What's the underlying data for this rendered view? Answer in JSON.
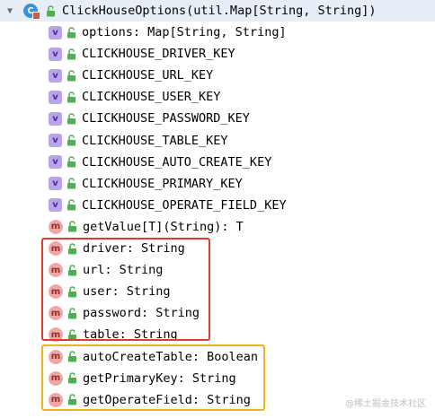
{
  "class_node": {
    "label": "ClickHouseOptions(util.Map[String, String])",
    "icon": "scala-class-icon",
    "icon_letter": "C",
    "expander": "expanded-arrow-icon"
  },
  "members": [
    {
      "kind": "val",
      "icon_letter": "v",
      "label": "options: Map[String, String]"
    },
    {
      "kind": "val",
      "icon_letter": "v",
      "label": "CLICKHOUSE_DRIVER_KEY"
    },
    {
      "kind": "val",
      "icon_letter": "v",
      "label": "CLICKHOUSE_URL_KEY"
    },
    {
      "kind": "val",
      "icon_letter": "v",
      "label": "CLICKHOUSE_USER_KEY"
    },
    {
      "kind": "val",
      "icon_letter": "v",
      "label": "CLICKHOUSE_PASSWORD_KEY"
    },
    {
      "kind": "val",
      "icon_letter": "v",
      "label": "CLICKHOUSE_TABLE_KEY"
    },
    {
      "kind": "val",
      "icon_letter": "v",
      "label": "CLICKHOUSE_AUTO_CREATE_KEY"
    },
    {
      "kind": "val",
      "icon_letter": "v",
      "label": "CLICKHOUSE_PRIMARY_KEY"
    },
    {
      "kind": "val",
      "icon_letter": "v",
      "label": "CLICKHOUSE_OPERATE_FIELD_KEY"
    },
    {
      "kind": "method",
      "icon_letter": "m",
      "label": "getValue[T](String): T"
    },
    {
      "kind": "method",
      "icon_letter": "m",
      "label": "driver: String"
    },
    {
      "kind": "method",
      "icon_letter": "m",
      "label": "url: String"
    },
    {
      "kind": "method",
      "icon_letter": "m",
      "label": "user: String"
    },
    {
      "kind": "method",
      "icon_letter": "m",
      "label": "password: String"
    },
    {
      "kind": "method",
      "icon_letter": "m",
      "label": "table: String"
    },
    {
      "kind": "method",
      "icon_letter": "m",
      "label": "autoCreateTable: Boolean"
    },
    {
      "kind": "method",
      "icon_letter": "m",
      "label": "getPrimaryKey: String"
    },
    {
      "kind": "method",
      "icon_letter": "m",
      "label": "getOperateField: String"
    }
  ],
  "annotations": {
    "red_box_color": "#e03a31",
    "yellow_box_color": "#f2b31a"
  },
  "colors": {
    "val_icon_bg": "#b8a4e8",
    "method_icon_bg": "#f2a5a5",
    "class_icon_bg": "#3d8fd8",
    "lock_green": "#4caf50",
    "selected_row_bg": "#e8eef8"
  },
  "watermark": "@稀土掘金技术社区"
}
